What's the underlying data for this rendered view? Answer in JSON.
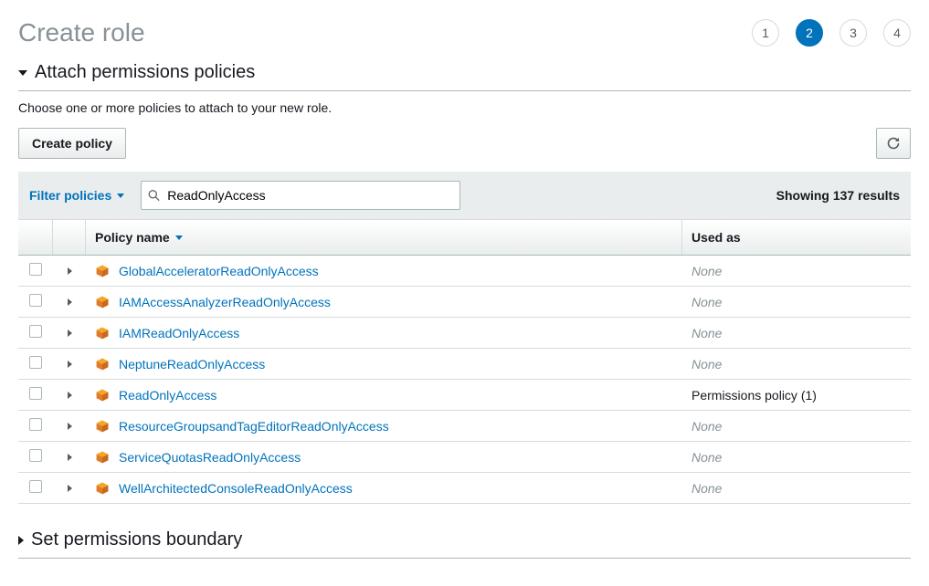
{
  "page_title": "Create role",
  "stepper": [
    "1",
    "2",
    "3",
    "4"
  ],
  "active_step": 1,
  "section_attach": {
    "title": "Attach permissions policies",
    "subtext": "Choose one or more policies to attach to your new role."
  },
  "toolbar": {
    "create_policy_label": "Create policy"
  },
  "filter": {
    "filter_label": "Filter policies",
    "search_value": "ReadOnlyAccess",
    "results_text": "Showing 137 results"
  },
  "table": {
    "header_policy": "Policy name",
    "header_used": "Used as",
    "rows": [
      {
        "name": "GlobalAcceleratorReadOnlyAccess",
        "used": "None",
        "none": true
      },
      {
        "name": "IAMAccessAnalyzerReadOnlyAccess",
        "used": "None",
        "none": true
      },
      {
        "name": "IAMReadOnlyAccess",
        "used": "None",
        "none": true
      },
      {
        "name": "NeptuneReadOnlyAccess",
        "used": "None",
        "none": true
      },
      {
        "name": "ReadOnlyAccess",
        "used": "Permissions policy (1)",
        "none": false
      },
      {
        "name": "ResourceGroupsandTagEditorReadOnlyAccess",
        "used": "None",
        "none": true
      },
      {
        "name": "ServiceQuotasReadOnlyAccess",
        "used": "None",
        "none": true
      },
      {
        "name": "WellArchitectedConsoleReadOnlyAccess",
        "used": "None",
        "none": true
      }
    ]
  },
  "section_boundary": {
    "title": "Set permissions boundary"
  }
}
